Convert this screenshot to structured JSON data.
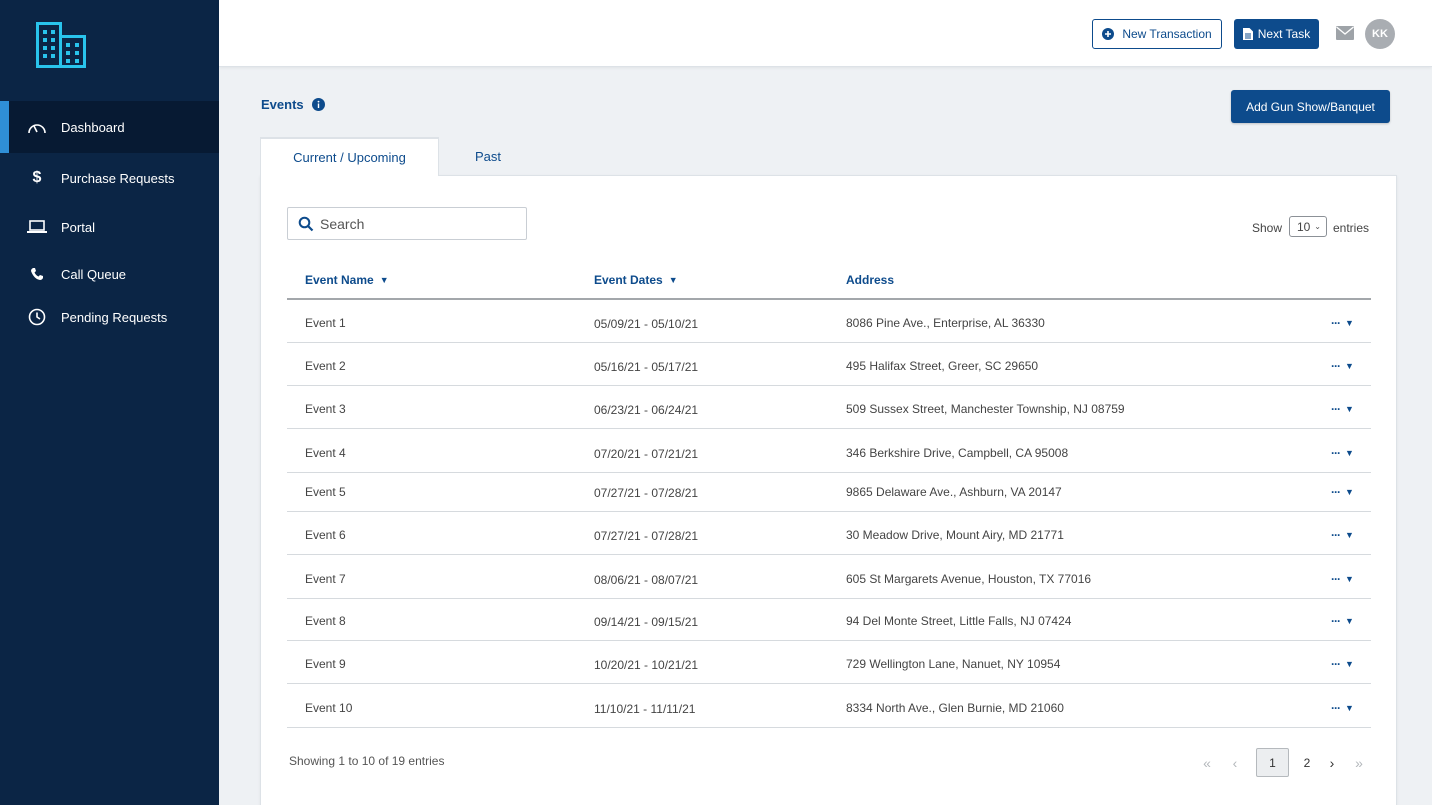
{
  "sidebar": {
    "logo_icon": "building-icon",
    "items": [
      {
        "label": "Dashboard",
        "icon": "speedometer-icon",
        "active": true
      },
      {
        "label": "Purchase Requests",
        "icon": "dollar-icon",
        "active": false
      },
      {
        "label": "Portal",
        "icon": "laptop-icon",
        "active": false
      },
      {
        "label": "Call Queue",
        "icon": "phone-icon",
        "active": false
      },
      {
        "label": "Pending Requests",
        "icon": "clock-icon",
        "active": false
      }
    ]
  },
  "header": {
    "new_transaction_label": "New Transaction",
    "next_task_label": "Next Task",
    "avatar_initials": "KK"
  },
  "page": {
    "title": "Events",
    "add_button_label": "Add Gun Show/Banquet"
  },
  "tabs": [
    {
      "label": "Current / Upcoming",
      "active": true
    },
    {
      "label": "Past",
      "active": false
    }
  ],
  "search": {
    "placeholder": "Search",
    "value": ""
  },
  "entries": {
    "show_label": "Show",
    "value": "10",
    "suffix": "entries"
  },
  "table": {
    "columns": [
      "Event Name",
      "Event Dates",
      "Address"
    ],
    "rows": [
      {
        "name": "Event 1",
        "dates": "05/09/21 - 05/10/21",
        "address": "8086 Pine Ave., Enterprise, AL 36330"
      },
      {
        "name": "Event 2",
        "dates": "05/16/21 - 05/17/21",
        "address": "495 Halifax Street, Greer, SC 29650"
      },
      {
        "name": "Event 3",
        "dates": "06/23/21 - 06/24/21",
        "address": "509 Sussex Street, Manchester Township, NJ 08759"
      },
      {
        "name": "Event 4",
        "dates": "07/20/21 - 07/21/21",
        "address": "346 Berkshire Drive, Campbell, CA 95008"
      },
      {
        "name": "Event 5",
        "dates": "07/27/21 - 07/28/21",
        "address": "9865 Delaware Ave., Ashburn, VA 20147"
      },
      {
        "name": "Event 6",
        "dates": "07/27/21 - 07/28/21",
        "address": "30 Meadow Drive, Mount Airy, MD 21771"
      },
      {
        "name": "Event 7",
        "dates": "08/06/21 - 08/07/21",
        "address": "605 St Margarets Avenue, Houston, TX 77016"
      },
      {
        "name": "Event 8",
        "dates": "09/14/21 - 09/15/21",
        "address": "94 Del Monte Street, Little Falls, NJ 07424"
      },
      {
        "name": "Event 9",
        "dates": "10/20/21 - 10/21/21",
        "address": "729 Wellington Lane, Nanuet, NY 10954"
      },
      {
        "name": "Event 10",
        "dates": "11/10/21 - 11/11/21",
        "address": "8334 North Ave., Glen Burnie, MD 21060"
      }
    ]
  },
  "footer": {
    "info": "Showing 1 to 10 of 19 entries",
    "pages": [
      "1",
      "2"
    ],
    "current_page": "1"
  },
  "colors": {
    "sidebar_bg": "#0b2545",
    "accent": "#0d4b8c",
    "active_indicator": "#2f8fd6",
    "logo": "#29c4ec"
  }
}
